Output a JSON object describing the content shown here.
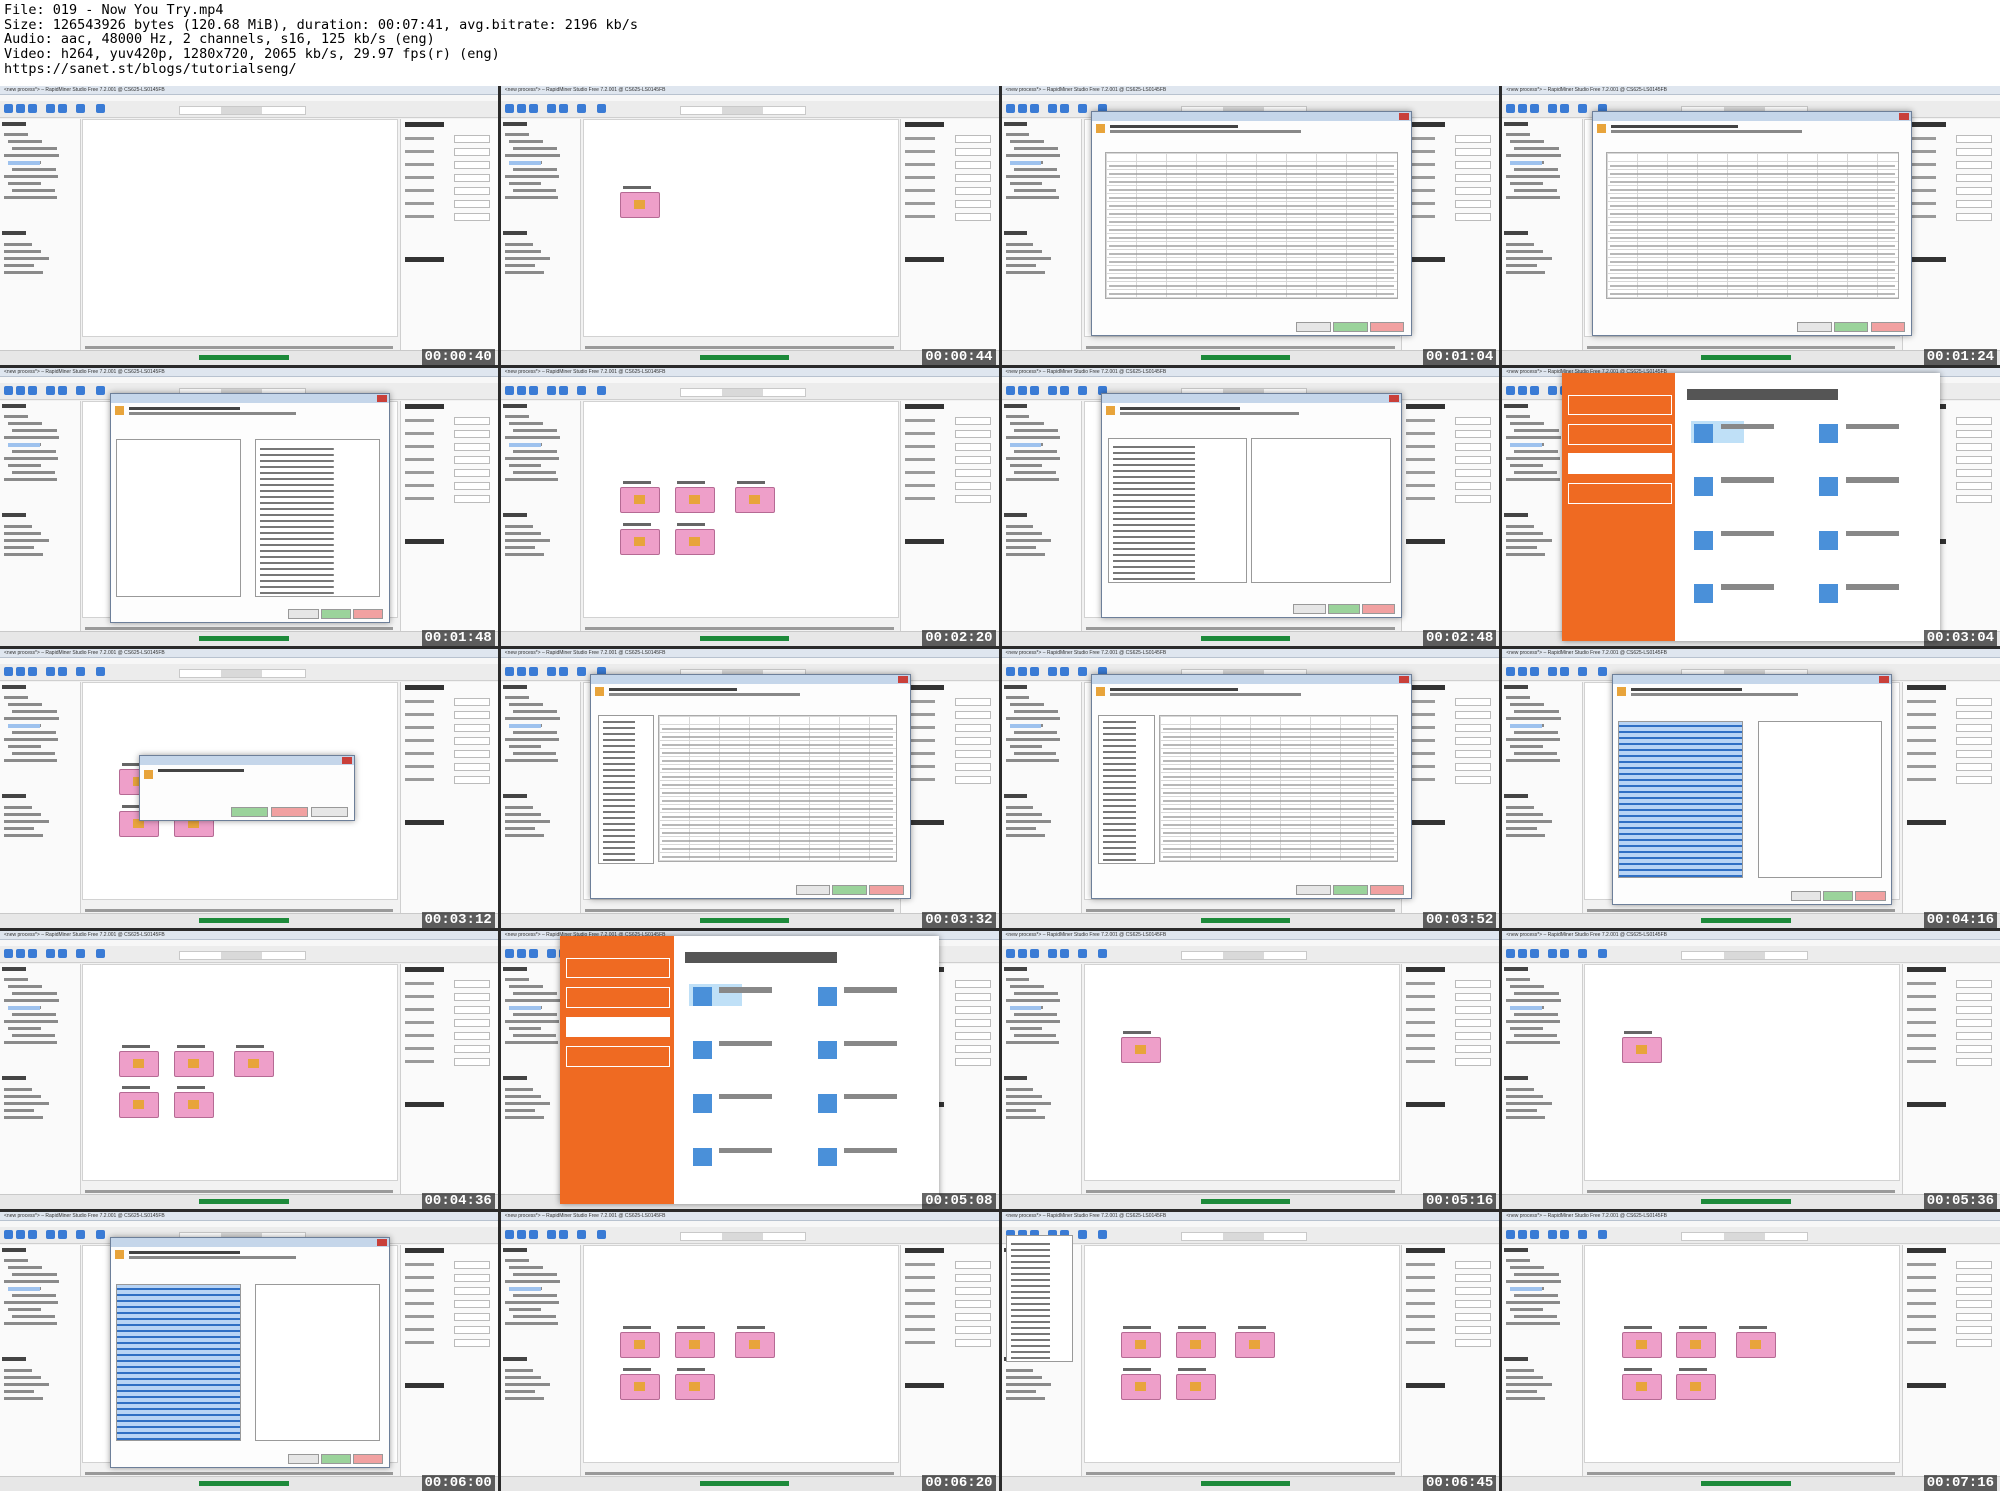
{
  "header": {
    "lines": [
      "File: 019 - Now You Try.mp4",
      "Size: 126543926 bytes (120.68 MiB), duration: 00:07:41, avg.bitrate: 2196 kb/s",
      "Audio: aac, 48000 Hz, 2 channels, s16, 125 kb/s (eng)",
      "Video: h264, yuv420p, 1280x720, 2065 kb/s, 29.97 fps(r) (eng)",
      "https://sanet.st/blogs/tutorialseng/"
    ]
  },
  "window_title": "<new process*> – RapidMiner Studio Free 7.2.001 @ CS625-LS0145FB",
  "thumbnails": [
    {
      "time": "00:00:40",
      "scene": "design"
    },
    {
      "time": "00:00:44",
      "scene": "design-operator"
    },
    {
      "time": "00:01:04",
      "scene": "import-wizard-step2"
    },
    {
      "time": "00:01:24",
      "scene": "import-wizard-step2"
    },
    {
      "time": "00:01:48",
      "scene": "select-attributes"
    },
    {
      "time": "00:02:20",
      "scene": "design-operators"
    },
    {
      "time": "00:02:48",
      "scene": "edit-parameter-list"
    },
    {
      "time": "00:03:04",
      "scene": "template-chooser"
    },
    {
      "time": "00:03:12",
      "scene": "save-changes"
    },
    {
      "time": "00:03:32",
      "scene": "import-wizard-step1"
    },
    {
      "time": "00:03:52",
      "scene": "import-wizard-step1"
    },
    {
      "time": "00:04:16",
      "scene": "select-attributes"
    },
    {
      "time": "00:04:36",
      "scene": "design-operators"
    },
    {
      "time": "00:05:08",
      "scene": "template-chooser"
    },
    {
      "time": "00:05:16",
      "scene": "design-operator"
    },
    {
      "time": "00:05:36",
      "scene": "design-operator"
    },
    {
      "time": "00:06:00",
      "scene": "select-attributes"
    },
    {
      "time": "00:06:20",
      "scene": "design-operators"
    },
    {
      "time": "00:06:45",
      "scene": "design-menu"
    },
    {
      "time": "00:07:16",
      "scene": "design-operators"
    }
  ],
  "dialogs": {
    "save_changes": "Save Changes",
    "save_prompt": "Save changes to unnamed?",
    "yes": "Yes",
    "no": "No",
    "cancel": "Cancel"
  },
  "template": {
    "heading": "Choose a template to start from:",
    "menu": [
      "GET STARTED",
      "LEARN",
      "NEW PROCESS",
      "OPEN PROCESS"
    ],
    "cards": [
      "Blank",
      "Churn Modeling",
      "Direct Marketing",
      "Credit Risk Modeling",
      "Market Basket Analysis",
      "Predictive Maintenance",
      "Price Risk Clustering",
      "Lift Chart"
    ]
  },
  "colors": {
    "accent_orange": "#ef6a22",
    "operator_pink": "#ee9fc9",
    "selection_blue": "#2f6fc4",
    "ok_green": "#1d8a3a"
  }
}
